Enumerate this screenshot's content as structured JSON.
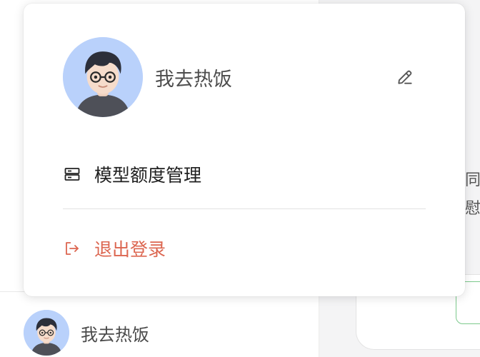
{
  "user": {
    "name": "我去热饭",
    "avatar_icon": "avatar-illustration"
  },
  "popover": {
    "edit_icon": "pencil-icon",
    "menu": {
      "quota": {
        "label": "模型额度管理",
        "icon": "server-icon"
      },
      "logout": {
        "label": "退出登录",
        "icon": "logout-icon",
        "color": "#dc6650"
      }
    }
  },
  "background": {
    "right_text_line1": "同",
    "right_text_line2": "慰",
    "accent_color": "#7cc98c"
  },
  "footer": {
    "name": "我去热饭"
  }
}
